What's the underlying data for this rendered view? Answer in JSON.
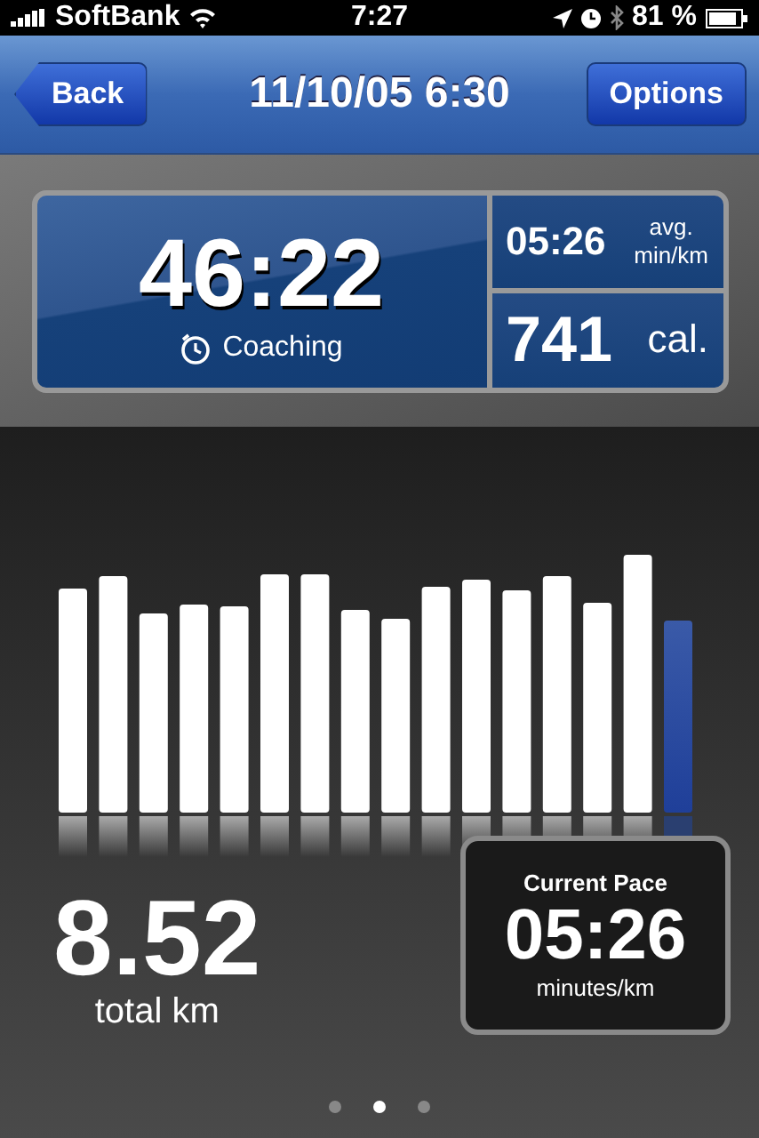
{
  "status_bar": {
    "carrier": "SoftBank",
    "time": "7:27",
    "battery": "81 %"
  },
  "nav": {
    "back": "Back",
    "title": "11/10/05 6:30",
    "options": "Options"
  },
  "summary": {
    "duration": "46:22",
    "mode": "Coaching",
    "avg_pace": "05:26",
    "avg_label": [
      "avg.",
      "min/km"
    ],
    "calories": "741",
    "calories_unit": "cal."
  },
  "distance": {
    "value": "8.52",
    "unit": "total km"
  },
  "current_pace": {
    "title": "Current Pace",
    "value": "05:26",
    "unit": "minutes/km"
  },
  "pages": [
    {
      "selected": false
    },
    {
      "selected": true
    },
    {
      "selected": false
    }
  ]
}
